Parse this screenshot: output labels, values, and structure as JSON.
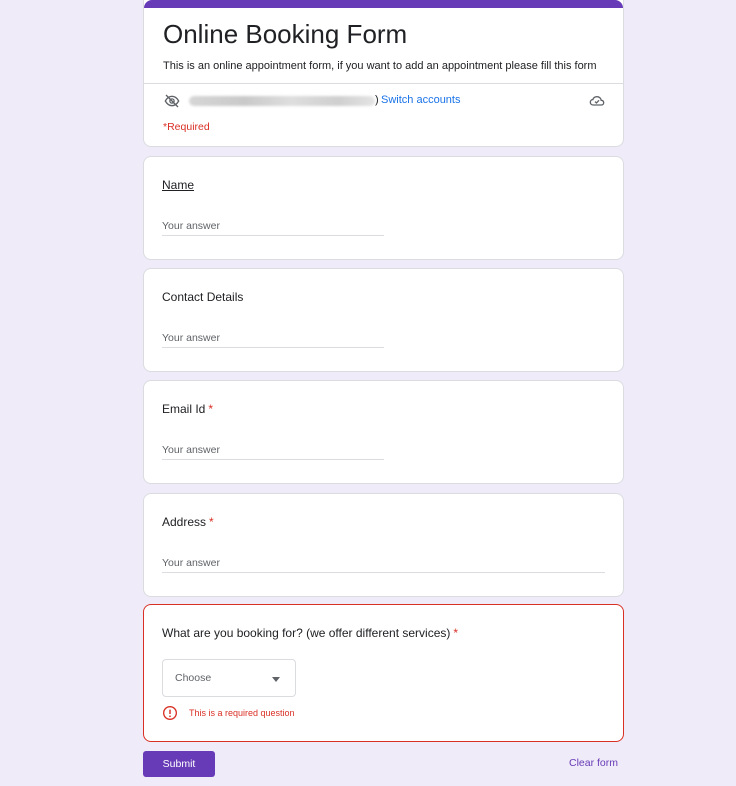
{
  "header": {
    "title": "Online Booking Form",
    "description": "This is an online appointment form, if you want to add an appointment please fill this form",
    "account_suffix": ")",
    "switch_accounts": "Switch accounts",
    "required_note": "*Required"
  },
  "questions": [
    {
      "label": "Name",
      "required": false,
      "placeholder": "Your answer"
    },
    {
      "label": "Contact Details",
      "required": false,
      "placeholder": "Your answer"
    },
    {
      "label": "Email Id",
      "required": true,
      "placeholder": "Your answer"
    },
    {
      "label": "Address",
      "required": true,
      "placeholder": "Your answer"
    },
    {
      "label": "What are you booking for? (we offer different services)",
      "required": true,
      "select_value": "Choose",
      "error": "This is a required question"
    }
  ],
  "required_marker": "*",
  "actions": {
    "submit": "Submit",
    "clear": "Clear form"
  },
  "colors": {
    "accent": "#673ab7",
    "link": "#1a73e8",
    "error": "#d93025",
    "background": "#efebf8"
  },
  "icons": [
    "eye-off-icon",
    "cloud-check-icon",
    "dropdown-caret-icon",
    "alert-circle-icon"
  ]
}
